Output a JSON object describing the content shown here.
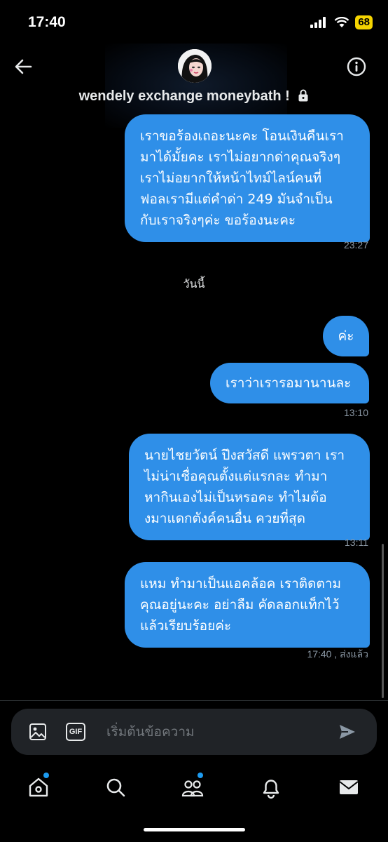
{
  "status_bar": {
    "time": "17:40",
    "battery": "68"
  },
  "header": {
    "chat_name": "wendely exchange moneybath !",
    "back_icon": "arrow-left-icon",
    "info_icon": "info-icon",
    "lock_icon": "lock-icon"
  },
  "messages": [
    {
      "lines": [
        "เราขอร้องเถอะนะคะ โอนเงินคืนเรา",
        "มาได้มั้ยคะ เราไม่อยากด่าคุณจริงๆ",
        "เราไม่อยากให้หน้าไทม์ไลน์คนที่",
        "ฟอลเรามีแต่คำด่า 249 มันจำเป็น",
        "กับเราจริงๆค่ะ ขอร้องนะคะ"
      ],
      "time": "23:27"
    },
    {
      "lines": [
        "ค่ะ"
      ],
      "time": ""
    },
    {
      "lines": [
        "เราว่าเรารอมานานละ"
      ],
      "time": "13:10"
    },
    {
      "lines": [
        "นายไชยวัตน์ ปึงสวัสดี แพรวตา เรา",
        "ไม่น่าเชื่อคุณตั้งแต่แรกละ ทำมา",
        "หากินเองไม่เป็นหรอคะ ทำไมต้อ",
        "งมาแดกตังค์คนอื่น ควยที่สุด"
      ],
      "time": "13:11"
    },
    {
      "lines": [
        "แหม ทำมาเป็นแอคล้อค เราติดตาม",
        "คุณอยู่นะคะ อย่าลืม คัดลอกแท็กไว้",
        "แล้วเรียบร้อยค่ะ"
      ],
      "time": "17:40 , ส่งแล้ว"
    }
  ],
  "date_separator": "วันนี้",
  "composer": {
    "placeholder": "เริ่มต้นข้อความ",
    "gif_label": "GIF",
    "image_icon": "image-icon",
    "send_icon": "send-icon"
  },
  "nav": {
    "items": [
      "home-icon",
      "search-icon",
      "communities-icon",
      "bell-icon",
      "mail-icon"
    ]
  },
  "colors": {
    "bubble": "#2f8fe8",
    "background": "#000000",
    "accent": "#1d9bf0",
    "battery": "#f5d400"
  }
}
